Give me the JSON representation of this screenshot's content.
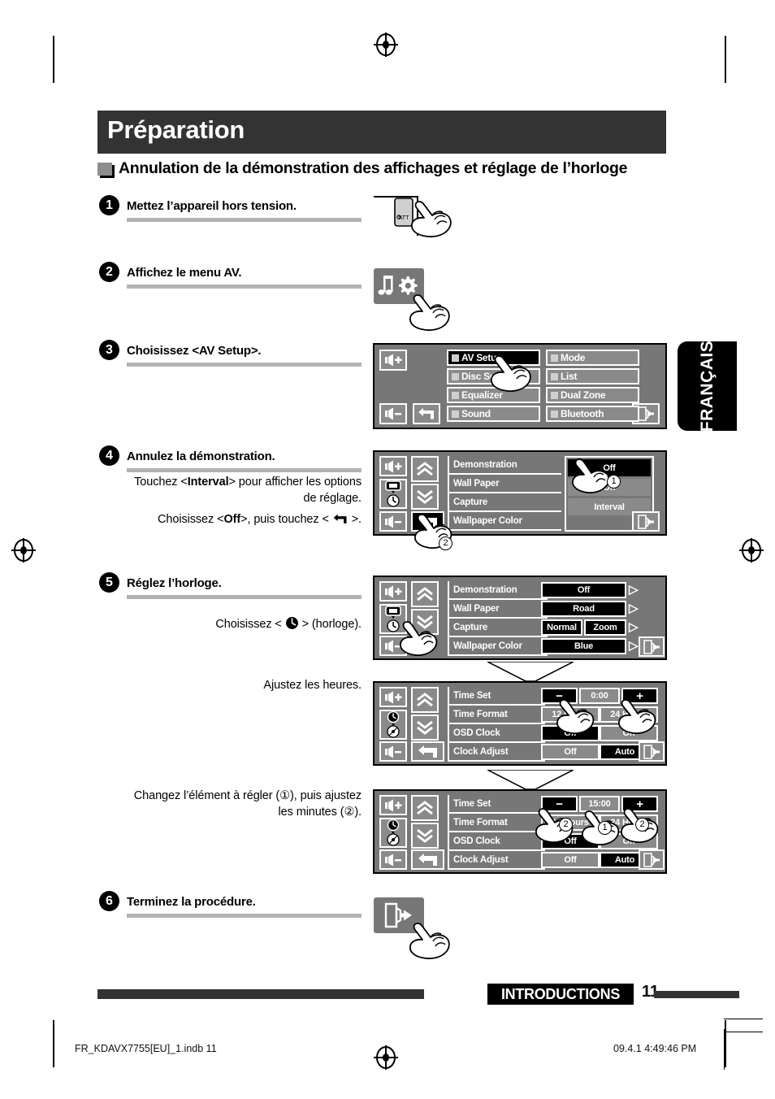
{
  "banner": {
    "title": "Préparation"
  },
  "section": {
    "title": "Annulation de la démonstration des affichages et réglage de l’horloge"
  },
  "language_tab": {
    "label": "FRANÇAIS"
  },
  "steps": [
    {
      "number": "1",
      "title": "Mettez l’appareil hors tension."
    },
    {
      "number": "2",
      "title": "Affichez le menu AV."
    },
    {
      "number": "3",
      "title": "Choisissez <AV Setup>."
    },
    {
      "number": "4",
      "title": "Annulez la démonstration.",
      "notes": [
        {
          "prefix": "Touchez <",
          "bold": "Interval",
          "suffix": "> pour afficher les options de réglage."
        },
        {
          "prefix": "Choisissez <",
          "bold": "Off",
          "suffix": ">, puis touchez < ",
          "icon": "return-arrow-icon",
          "tail": " >."
        }
      ]
    },
    {
      "number": "5",
      "title": "Réglez l’horloge.",
      "notes": [
        {
          "prefix": "Choisissez < ",
          "icon": "clock-icon",
          "suffix": " > (horloge)."
        },
        {
          "text": "Ajustez les heures."
        },
        {
          "text": "Changez l’élément à régler (①), puis ajustez les minutes (②)."
        }
      ]
    },
    {
      "number": "6",
      "title": "Terminez la procédure."
    }
  ],
  "step1_device": {
    "button_label": "ATT",
    "hand": "pointing-hand-icon"
  },
  "step2_icon": {
    "icons": [
      "music-note-icon",
      "gear-icon"
    ],
    "hand": "pointing-hand-icon"
  },
  "step6_icon": {
    "icons": [
      "exit-icon"
    ],
    "hand": "pointing-hand-icon"
  },
  "panels": {
    "av_menu": {
      "name": "AV Menu",
      "side_buttons": [
        "volume-up-icon",
        "volume-down-icon",
        "return-arrow-icon"
      ],
      "exit_button": "exit-icon",
      "items": [
        {
          "label": "AV Setup",
          "selected": true
        },
        {
          "label": "Mode",
          "selected": false
        },
        {
          "label": "Disc Surround",
          "selected": false
        },
        {
          "label": "List",
          "selected": false
        },
        {
          "label": "Equalizer",
          "selected": false
        },
        {
          "label": "Dual Zone",
          "selected": false
        },
        {
          "label": "Sound",
          "selected": false
        },
        {
          "label": "Bluetooth",
          "selected": false
        }
      ],
      "hand_marker": null
    },
    "display_demo": {
      "name": "Display setup — Demonstration",
      "side_buttons": [
        "volume-up-icon",
        "display-clock-icon",
        "volume-down-icon",
        "return-arrow-icon"
      ],
      "nav_buttons": [
        "chevron-up-icon",
        "chevron-down-icon"
      ],
      "exit_button": "exit-icon",
      "rows": [
        {
          "label": "Demonstration",
          "values": [
            {
              "text": "Off",
              "selected": true
            }
          ]
        },
        {
          "label": "Wall Paper",
          "values": [
            {
              "text": "On",
              "selected": false
            }
          ]
        },
        {
          "label": "Capture",
          "values": [
            {
              "text": "Interval",
              "selected": false
            }
          ]
        },
        {
          "label": "Wallpaper Color",
          "values": []
        }
      ],
      "markers": [
        {
          "id": "1",
          "target": "Off"
        },
        {
          "id": "2",
          "target": "return-arrow-icon"
        }
      ]
    },
    "display_list": {
      "name": "Display setup list",
      "side_buttons": [
        "volume-up-icon",
        "display-clock-icon",
        "volume-down-icon"
      ],
      "nav_buttons": [
        "chevron-up-icon",
        "chevron-down-icon"
      ],
      "exit_button": "exit-icon",
      "rows": [
        {
          "label": "Demonstration",
          "values": [
            {
              "text": "Off",
              "selected": true
            }
          ],
          "arrow": true
        },
        {
          "label": "Wall Paper",
          "values": [
            {
              "text": "Road",
              "selected": true
            }
          ],
          "arrow": true
        },
        {
          "label": "Capture",
          "values": [
            {
              "text": "Normal",
              "selected": true
            },
            {
              "text": "Zoom",
              "selected": true
            }
          ],
          "arrow": true
        },
        {
          "label": "Wallpaper Color",
          "values": [
            {
              "text": "Blue",
              "selected": true
            }
          ],
          "arrow": true
        }
      ]
    },
    "clock_0": {
      "name": "Clock setup — hours",
      "side_buttons": [
        "volume-up-icon",
        "clock-disc-icon",
        "volume-down-icon",
        "return-arrow-icon"
      ],
      "nav_buttons": [
        "chevron-up-icon",
        "chevron-down-icon"
      ],
      "exit_button": "exit-icon",
      "rows": [
        {
          "label": "Time Set",
          "minus": "−",
          "value": "0:00",
          "plus": "+"
        },
        {
          "label": "Time Format",
          "values": [
            {
              "text": "12 Hours",
              "selected": false
            },
            {
              "text": "24 Hours",
              "selected": false
            }
          ]
        },
        {
          "label": "OSD Clock",
          "values": [
            {
              "text": "Off",
              "selected": true
            },
            {
              "text": "On",
              "selected": false
            }
          ]
        },
        {
          "label": "Clock Adjust",
          "values": [
            {
              "text": "Off",
              "selected": false
            },
            {
              "text": "Auto",
              "selected": true
            }
          ]
        }
      ]
    },
    "clock_15": {
      "name": "Clock setup — minutes",
      "side_buttons": [
        "volume-up-icon",
        "clock-disc-icon",
        "volume-down-icon",
        "return-arrow-icon"
      ],
      "nav_buttons": [
        "chevron-up-icon",
        "chevron-down-icon"
      ],
      "exit_button": "exit-icon",
      "rows": [
        {
          "label": "Time Set",
          "minus": "−",
          "value": "15:00",
          "plus": "+"
        },
        {
          "label": "Time Format",
          "values": [
            {
              "text": "12 Hours",
              "selected": false
            },
            {
              "text": "24 Hours",
              "selected": false
            }
          ]
        },
        {
          "label": "OSD Clock",
          "values": [
            {
              "text": "Off",
              "selected": true
            },
            {
              "text": "On",
              "selected": false
            }
          ]
        },
        {
          "label": "Clock Adjust",
          "values": [
            {
              "text": "Off",
              "selected": false
            },
            {
              "text": "Auto",
              "selected": true
            }
          ]
        }
      ],
      "markers": [
        {
          "id": "2",
          "target": "minus"
        },
        {
          "id": "1",
          "target": "value"
        },
        {
          "id": "2",
          "target": "plus"
        }
      ]
    }
  },
  "footer": {
    "chapter": "INTRODUCTIONS",
    "page_number": "11",
    "imprint_left": "FR_KDAVX7755[EU]_1.indb   11",
    "imprint_right": "09.4.1   4:49:46 PM"
  }
}
